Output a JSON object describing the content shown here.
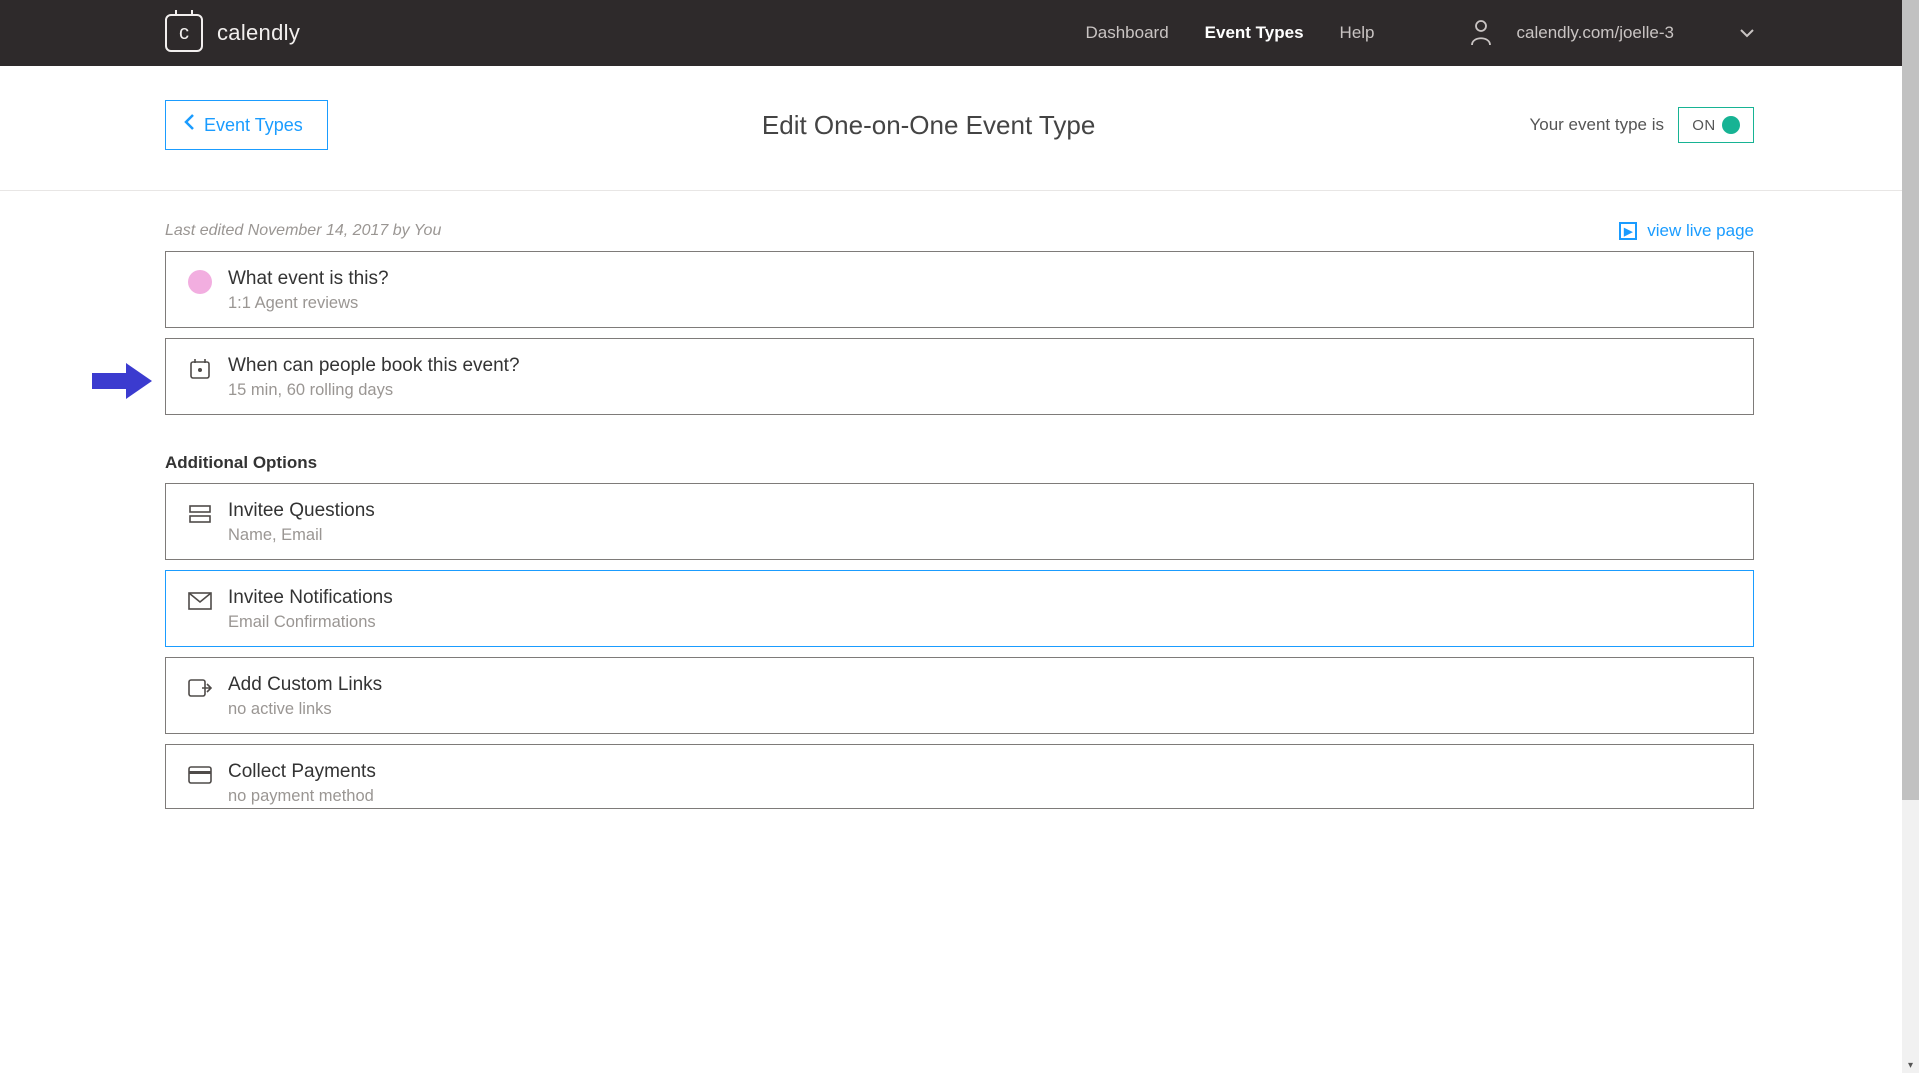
{
  "brand": {
    "name": "calendly",
    "mark": "c"
  },
  "nav": {
    "dashboard": "Dashboard",
    "event_types": "Event Types",
    "help": "Help"
  },
  "user": {
    "url": "calendly.com/joelle-3"
  },
  "subheader": {
    "back": "Event Types",
    "title": "Edit One-on-One Event Type",
    "toggle_label": "Your event type is",
    "toggle_state": "ON"
  },
  "meta": {
    "last_edited": "Last edited November 14, 2017 by You",
    "view_live": "view live page"
  },
  "cards": {
    "what": {
      "title": "What event is this?",
      "sub": "1:1 Agent reviews"
    },
    "when": {
      "title": "When can people book this event?",
      "sub": "15 min, 60 rolling days"
    }
  },
  "additional_heading": "Additional Options",
  "options": {
    "questions": {
      "title": "Invitee Questions",
      "sub": "Name, Email"
    },
    "notifications": {
      "title": "Invitee Notifications",
      "sub": "Email Confirmations"
    },
    "custom_links": {
      "title": "Add Custom Links",
      "sub": "no active links"
    },
    "payments": {
      "title": "Collect Payments",
      "sub": "no payment method"
    }
  }
}
